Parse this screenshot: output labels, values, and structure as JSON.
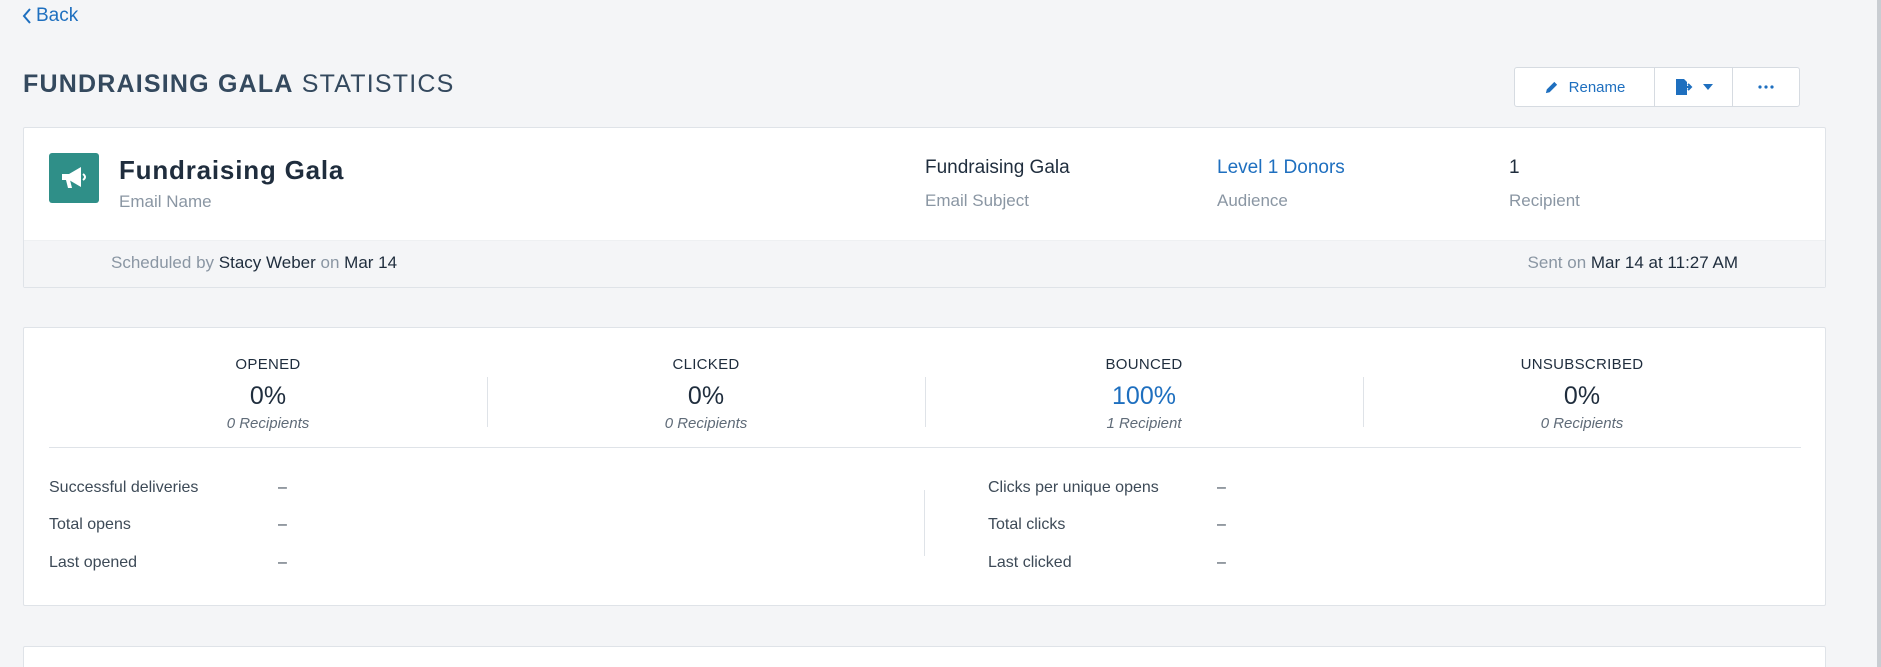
{
  "nav": {
    "back_label": "Back"
  },
  "header": {
    "title_strong": "FUNDRAISING GALA",
    "title_rest": "STATISTICS",
    "toolbar": {
      "rename_label": "Rename",
      "export_icon": "export-document-icon",
      "more_icon": "ellipsis-icon"
    }
  },
  "summary": {
    "icon": "megaphone-icon",
    "email_name": "Fundraising Gala",
    "email_name_label": "Email Name",
    "subject": "Fundraising Gala",
    "subject_label": "Email Subject",
    "audience": "Level 1 Donors",
    "audience_label": "Audience",
    "recipients": "1",
    "recipients_label": "Recipient",
    "scheduled_prefix": "Scheduled by",
    "scheduled_by": "Stacy Weber",
    "scheduled_on_word": "on",
    "scheduled_date": "Mar 14",
    "sent_prefix": "Sent on",
    "sent_datetime": "Mar 14 at 11:27 AM"
  },
  "stats": {
    "tiles": [
      {
        "label": "OPENED",
        "value": "0%",
        "sub": "0 Recipients"
      },
      {
        "label": "CLICKED",
        "value": "0%",
        "sub": "0 Recipients"
      },
      {
        "label": "BOUNCED",
        "value": "100%",
        "sub": "1 Recipient"
      },
      {
        "label": "UNSUBSCRIBED",
        "value": "0%",
        "sub": "0 Recipients"
      }
    ],
    "details_left": [
      {
        "label": "Successful deliveries",
        "value": "–"
      },
      {
        "label": "Total opens",
        "value": "–"
      },
      {
        "label": "Last opened",
        "value": "–"
      }
    ],
    "details_right": [
      {
        "label": "Clicks per unique opens",
        "value": "–"
      },
      {
        "label": "Total clicks",
        "value": "–"
      },
      {
        "label": "Last clicked",
        "value": "–"
      }
    ]
  },
  "colors": {
    "accent": "#1e6fbf",
    "icon_bg": "#2f8f88",
    "page_bg": "#f4f5f7"
  }
}
